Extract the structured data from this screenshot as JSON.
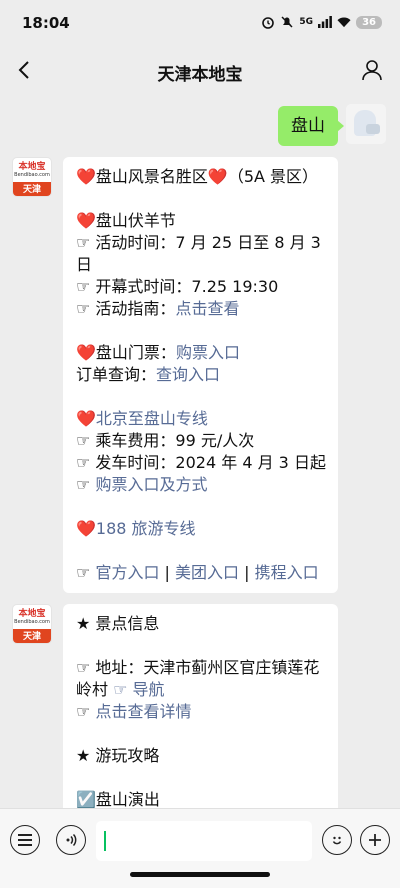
{
  "status_bar": {
    "time": "18:04",
    "signal_label": "5G",
    "battery": "36"
  },
  "nav": {
    "title": "天津本地宝"
  },
  "outgoing": {
    "text": "盘山"
  },
  "account": {
    "logo_text": "本地宝",
    "logo_sub": "Bendibao.com",
    "logo_city": "天津"
  },
  "message1": {
    "title_pre": "❤️盘山风景名胜区❤️（5A 景区）",
    "festival": "❤️盘山伏羊节",
    "activity_time": "☞ 活动时间：7 月 25 日至 8 月 3 日",
    "opening_time": "☞ 开幕式时间：7.25 19:30",
    "guide_label": "☞ 活动指南：",
    "guide_link": "点击查看",
    "tickets_label": "❤️盘山门票：",
    "tickets_link": "购票入口",
    "order_label": "订单查询：",
    "order_link": "查询入口",
    "bus_heart": "❤️",
    "bus_link": "北京至盘山专线",
    "fare": "☞ 乘车费用：99 元/人次",
    "depart": "☞ 发车时间：2024 年 4 月 3 日起",
    "buy_prefix": "☞ ",
    "buy_link": "购票入口及方式",
    "tour_heart": "❤️",
    "tour_link": "188 旅游专线",
    "links_prefix": "☞ ",
    "official_link": "官方入口",
    "sep": " | ",
    "meituan_link": "美团入口",
    "ctrip_link": "携程入口"
  },
  "message2": {
    "info_title": "★ 景点信息",
    "address": "☞ 地址：天津市蓟州区官庄镇莲花岭村 ",
    "nav_link": "☞ 导航",
    "detail_prefix": "☞ ",
    "detail_link": "点击查看详情",
    "guide_title": "★ 游玩攻略",
    "show": "☑️盘山演出"
  },
  "input_bar": {
    "placeholder": ""
  }
}
